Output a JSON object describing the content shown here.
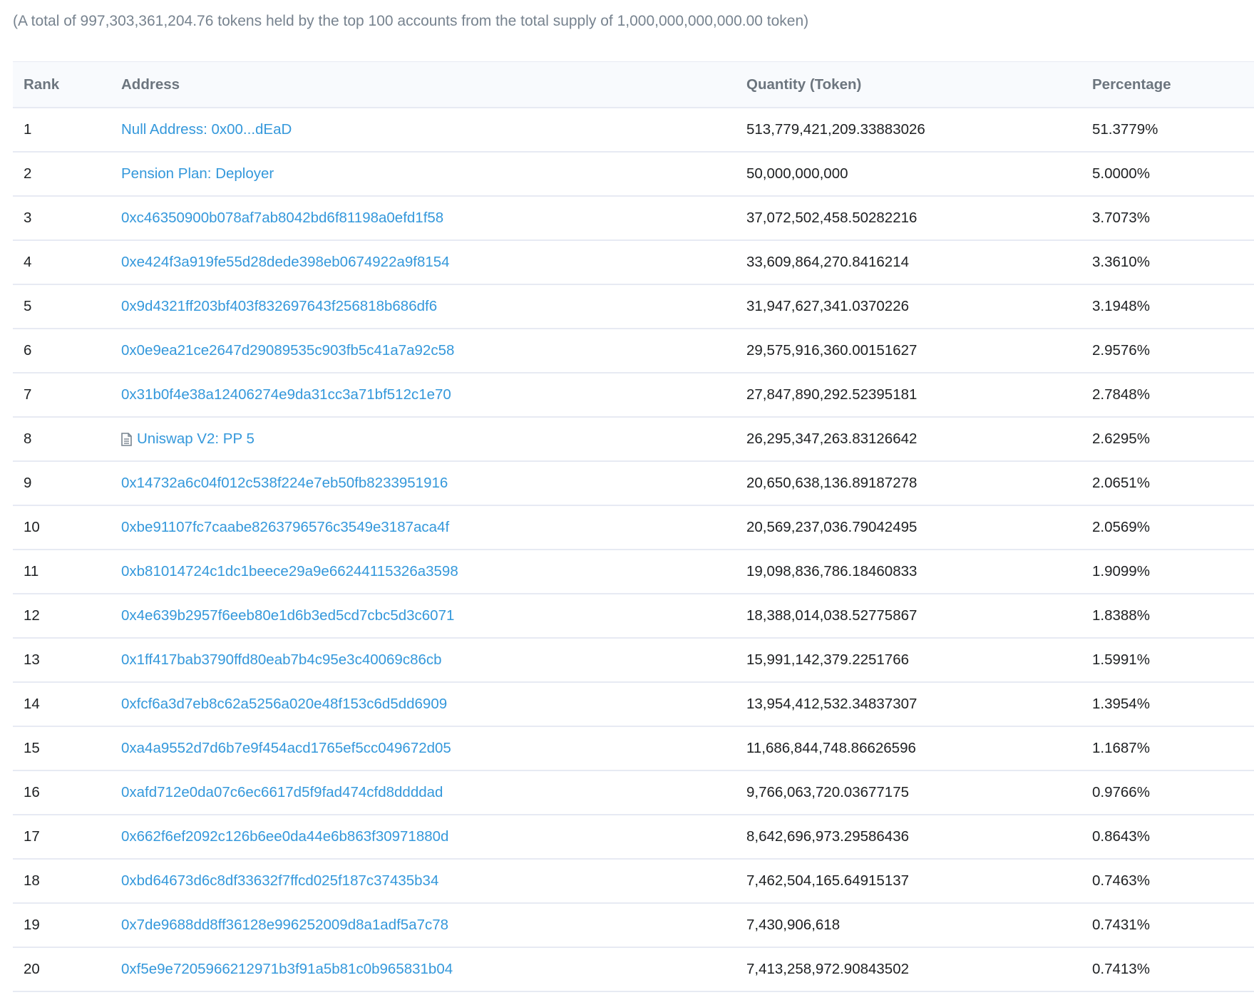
{
  "summary_text": "(A total of 997,303,361,204.76 tokens held by the top 100 accounts from the total supply of 1,000,000,000,000.00 token)",
  "table": {
    "headers": {
      "rank": "Rank",
      "address": "Address",
      "quantity": "Quantity (Token)",
      "percentage": "Percentage"
    },
    "rows": [
      {
        "rank": "1",
        "address": "Null Address: 0x00...dEaD",
        "contract": false,
        "quantity": "513,779,421,209.33883026",
        "percentage": "51.3779%"
      },
      {
        "rank": "2",
        "address": "Pension Plan: Deployer",
        "contract": false,
        "quantity": "50,000,000,000",
        "percentage": "5.0000%"
      },
      {
        "rank": "3",
        "address": "0xc46350900b078af7ab8042bd6f81198a0efd1f58",
        "contract": false,
        "quantity": "37,072,502,458.50282216",
        "percentage": "3.7073%"
      },
      {
        "rank": "4",
        "address": "0xe424f3a919fe55d28dede398eb0674922a9f8154",
        "contract": false,
        "quantity": "33,609,864,270.8416214",
        "percentage": "3.3610%"
      },
      {
        "rank": "5",
        "address": "0x9d4321ff203bf403f832697643f256818b686df6",
        "contract": false,
        "quantity": "31,947,627,341.0370226",
        "percentage": "3.1948%"
      },
      {
        "rank": "6",
        "address": "0x0e9ea21ce2647d29089535c903fb5c41a7a92c58",
        "contract": false,
        "quantity": "29,575,916,360.00151627",
        "percentage": "2.9576%"
      },
      {
        "rank": "7",
        "address": "0x31b0f4e38a12406274e9da31cc3a71bf512c1e70",
        "contract": false,
        "quantity": "27,847,890,292.52395181",
        "percentage": "2.7848%"
      },
      {
        "rank": "8",
        "address": "Uniswap V2: PP 5",
        "contract": true,
        "quantity": "26,295,347,263.83126642",
        "percentage": "2.6295%"
      },
      {
        "rank": "9",
        "address": "0x14732a6c04f012c538f224e7eb50fb8233951916",
        "contract": false,
        "quantity": "20,650,638,136.89187278",
        "percentage": "2.0651%"
      },
      {
        "rank": "10",
        "address": "0xbe91107fc7caabe8263796576c3549e3187aca4f",
        "contract": false,
        "quantity": "20,569,237,036.79042495",
        "percentage": "2.0569%"
      },
      {
        "rank": "11",
        "address": "0xb81014724c1dc1beece29a9e66244115326a3598",
        "contract": false,
        "quantity": "19,098,836,786.18460833",
        "percentage": "1.9099%"
      },
      {
        "rank": "12",
        "address": "0x4e639b2957f6eeb80e1d6b3ed5cd7cbc5d3c6071",
        "contract": false,
        "quantity": "18,388,014,038.52775867",
        "percentage": "1.8388%"
      },
      {
        "rank": "13",
        "address": "0x1ff417bab3790ffd80eab7b4c95e3c40069c86cb",
        "contract": false,
        "quantity": "15,991,142,379.2251766",
        "percentage": "1.5991%"
      },
      {
        "rank": "14",
        "address": "0xfcf6a3d7eb8c62a5256a020e48f153c6d5dd6909",
        "contract": false,
        "quantity": "13,954,412,532.34837307",
        "percentage": "1.3954%"
      },
      {
        "rank": "15",
        "address": "0xa4a9552d7d6b7e9f454acd1765ef5cc049672d05",
        "contract": false,
        "quantity": "11,686,844,748.86626596",
        "percentage": "1.1687%"
      },
      {
        "rank": "16",
        "address": "0xafd712e0da07c6ec6617d5f9fad474cfd8ddddad",
        "contract": false,
        "quantity": "9,766,063,720.03677175",
        "percentage": "0.9766%"
      },
      {
        "rank": "17",
        "address": "0x662f6ef2092c126b6ee0da44e6b863f30971880d",
        "contract": false,
        "quantity": "8,642,696,973.29586436",
        "percentage": "0.8643%"
      },
      {
        "rank": "18",
        "address": "0xbd64673d6c8df33632f7ffcd025f187c37435b34",
        "contract": false,
        "quantity": "7,462,504,165.64915137",
        "percentage": "0.7463%"
      },
      {
        "rank": "19",
        "address": "0x7de9688dd8ff36128e996252009d8a1adf5a7c78",
        "contract": false,
        "quantity": "7,430,906,618",
        "percentage": "0.7431%"
      },
      {
        "rank": "20",
        "address": "0xf5e9e7205966212971b3f91a5b81c0b965831b04",
        "contract": false,
        "quantity": "7,413,258,972.90843502",
        "percentage": "0.7413%"
      }
    ]
  },
  "colors": {
    "link": "#3498db",
    "muted_text": "#77838f",
    "header_bg": "#f8fafd",
    "border": "#e7eaf3"
  },
  "icons": {
    "contract": "contract-document-icon"
  }
}
